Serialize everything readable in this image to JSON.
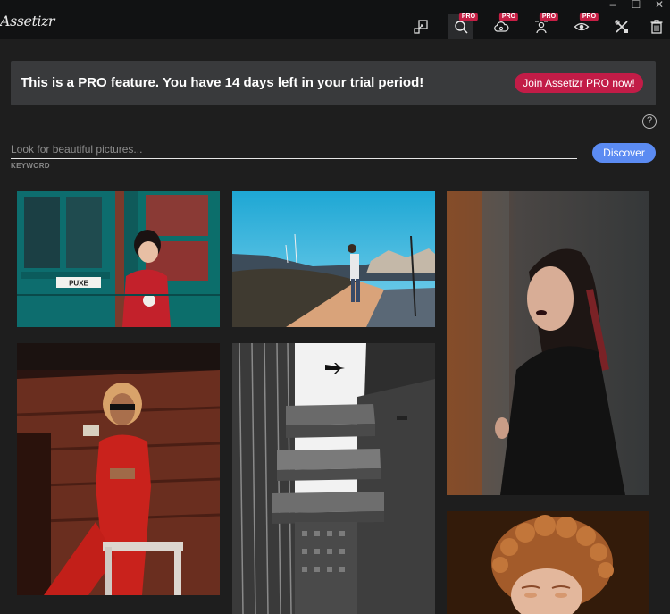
{
  "app": {
    "logo_text": "Assetizr"
  },
  "window_controls": [
    "–",
    "☐",
    "✕"
  ],
  "toolbar": {
    "pro_label": "PRO",
    "buttons": [
      {
        "name": "resize",
        "pro": false
      },
      {
        "name": "search",
        "pro": true,
        "active": true
      },
      {
        "name": "cloud",
        "pro": true
      },
      {
        "name": "text-overlay",
        "pro": true
      },
      {
        "name": "preview",
        "pro": true
      },
      {
        "name": "tools",
        "pro": false
      },
      {
        "name": "trash",
        "pro": false
      }
    ]
  },
  "banner": {
    "message": "This is a PRO feature. You have 14 days left in your trial period!",
    "cta_label": "Join Assetizr PRO now!"
  },
  "help": {
    "glyph": "?"
  },
  "search": {
    "placeholder": "Look for beautiful pictures...",
    "value": "",
    "field_label": "KEYWORD",
    "discover_label": "Discover"
  },
  "gallery": {
    "photos": [
      {
        "name": "girl-in-doorway",
        "sign_text": "PUXE"
      },
      {
        "name": "photographer-on-pier"
      },
      {
        "name": "woman-dark-lipstick"
      },
      {
        "name": "woman-in-red"
      },
      {
        "name": "building-airplane"
      },
      {
        "name": "curly-hair-portrait"
      }
    ]
  },
  "colors": {
    "background": "#1e1e1e",
    "topbar": "#111213",
    "banner": "#393a3c",
    "pro_red": "#c61f45",
    "discover_blue": "#5b8bf2"
  }
}
